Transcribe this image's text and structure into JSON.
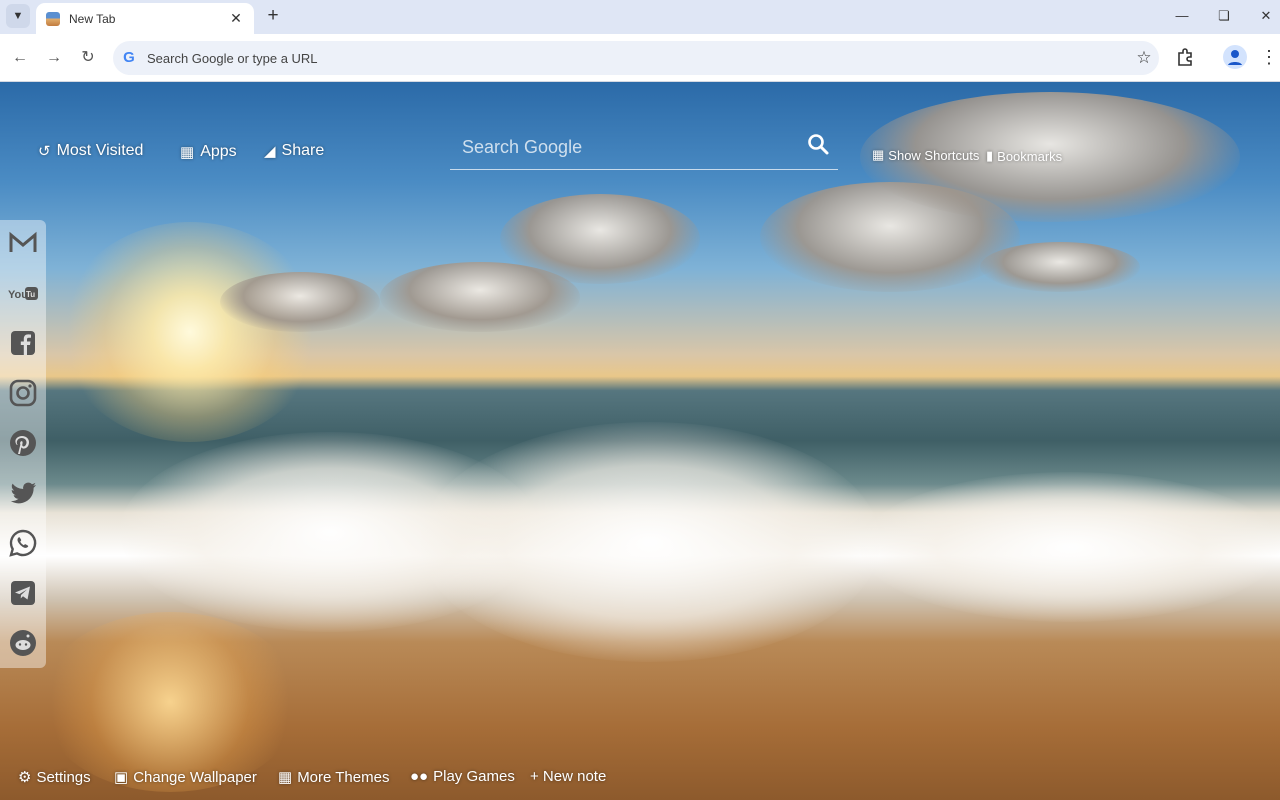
{
  "browser": {
    "tab": {
      "title": "New Tab"
    },
    "omnibox": {
      "placeholder": "Search Google or type a URL"
    }
  },
  "newtab": {
    "top_links": {
      "most_visited": "Most Visited",
      "apps": "Apps",
      "share": "Share",
      "show_shortcuts": "Show Shortcuts",
      "bookmarks": "Bookmarks"
    },
    "search": {
      "placeholder": "Search Google"
    },
    "social": [
      "Gmail",
      "YouTube",
      "Facebook",
      "Instagram",
      "Pinterest",
      "Twitter",
      "WhatsApp",
      "Telegram",
      "Reddit"
    ],
    "bottom": {
      "settings": "Settings",
      "change_wallpaper": "Change Wallpaper",
      "more_themes": "More Themes",
      "play_games": "Play Games",
      "new_note": "+ New note"
    }
  },
  "colors": {
    "chrome_frame": "#dfe6f5",
    "omnibox_bg": "#edf1f9",
    "overlay_text": "#ffffff"
  },
  "icons": [
    "chevron-down-icon",
    "close-icon",
    "plus-icon",
    "minimize-icon",
    "restore-icon",
    "back-icon",
    "forward-icon",
    "reload-icon",
    "google-icon",
    "star-icon",
    "extensions-icon",
    "profile-icon",
    "more-icon",
    "history-icon",
    "grid-icon",
    "share-icon",
    "search-icon",
    "windows-icon",
    "bookmark-icon",
    "gear-icon",
    "image-icon",
    "gamepad-icon"
  ]
}
